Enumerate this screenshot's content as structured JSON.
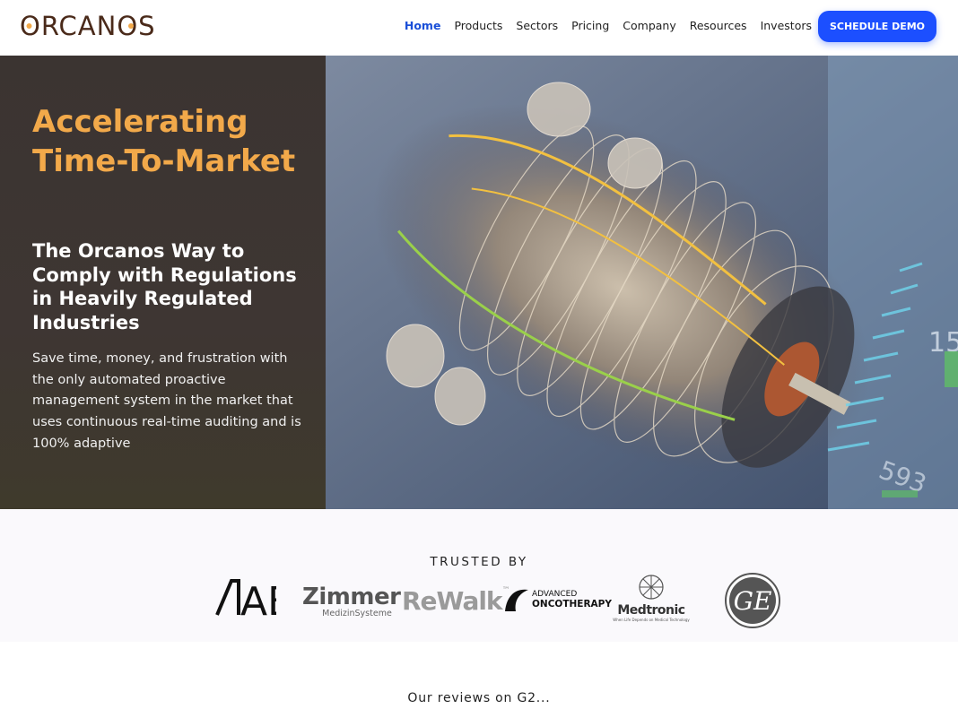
{
  "header": {
    "logo_text": "ORCANOS",
    "nav": [
      {
        "label": "Home",
        "active": true
      },
      {
        "label": "Products",
        "active": false
      },
      {
        "label": "Sectors",
        "active": false
      },
      {
        "label": "Pricing",
        "active": false
      },
      {
        "label": "Company",
        "active": false
      },
      {
        "label": "Resources",
        "active": false
      },
      {
        "label": "Investors",
        "active": false
      }
    ],
    "cta_label": "SCHEDULE DEMO"
  },
  "hero": {
    "title": "Accelerating Time-To-Market",
    "subtitle": "The Orcanos Way to Comply with Regulations in Heavily Regulated Industries",
    "body": "Save time, money, and frustration with the only automated proactive management system in the market that uses continuous real-time auditing and is 100% adaptive",
    "image_icon": "turbine-engine-image"
  },
  "trusted": {
    "label": "TRUSTED BY",
    "logos": [
      {
        "name": "AB",
        "text": "AB",
        "mark": "™"
      },
      {
        "name": "Zimmer",
        "text": "Zimmer",
        "sub": "MedizinSysteme"
      },
      {
        "name": "ReWalk",
        "text": "ReWalk",
        "mark": "™"
      },
      {
        "name": "Advanced Oncotherapy",
        "line1": "ADVANCED",
        "line2": "ONCOTHERAPY"
      },
      {
        "name": "Medtronic",
        "text": "Medtronic",
        "sub": "When Life Depends on Medical Technology"
      },
      {
        "name": "GE",
        "text": "GE"
      }
    ]
  },
  "reviews": {
    "label": "Our reviews on G2..."
  },
  "colors": {
    "accent": "#f2a94a",
    "primary_blue": "#1c4fff",
    "nav_active": "#1a4fd8",
    "hero_dark": "#3b3431",
    "logo_brown": "#4a2a1a"
  }
}
